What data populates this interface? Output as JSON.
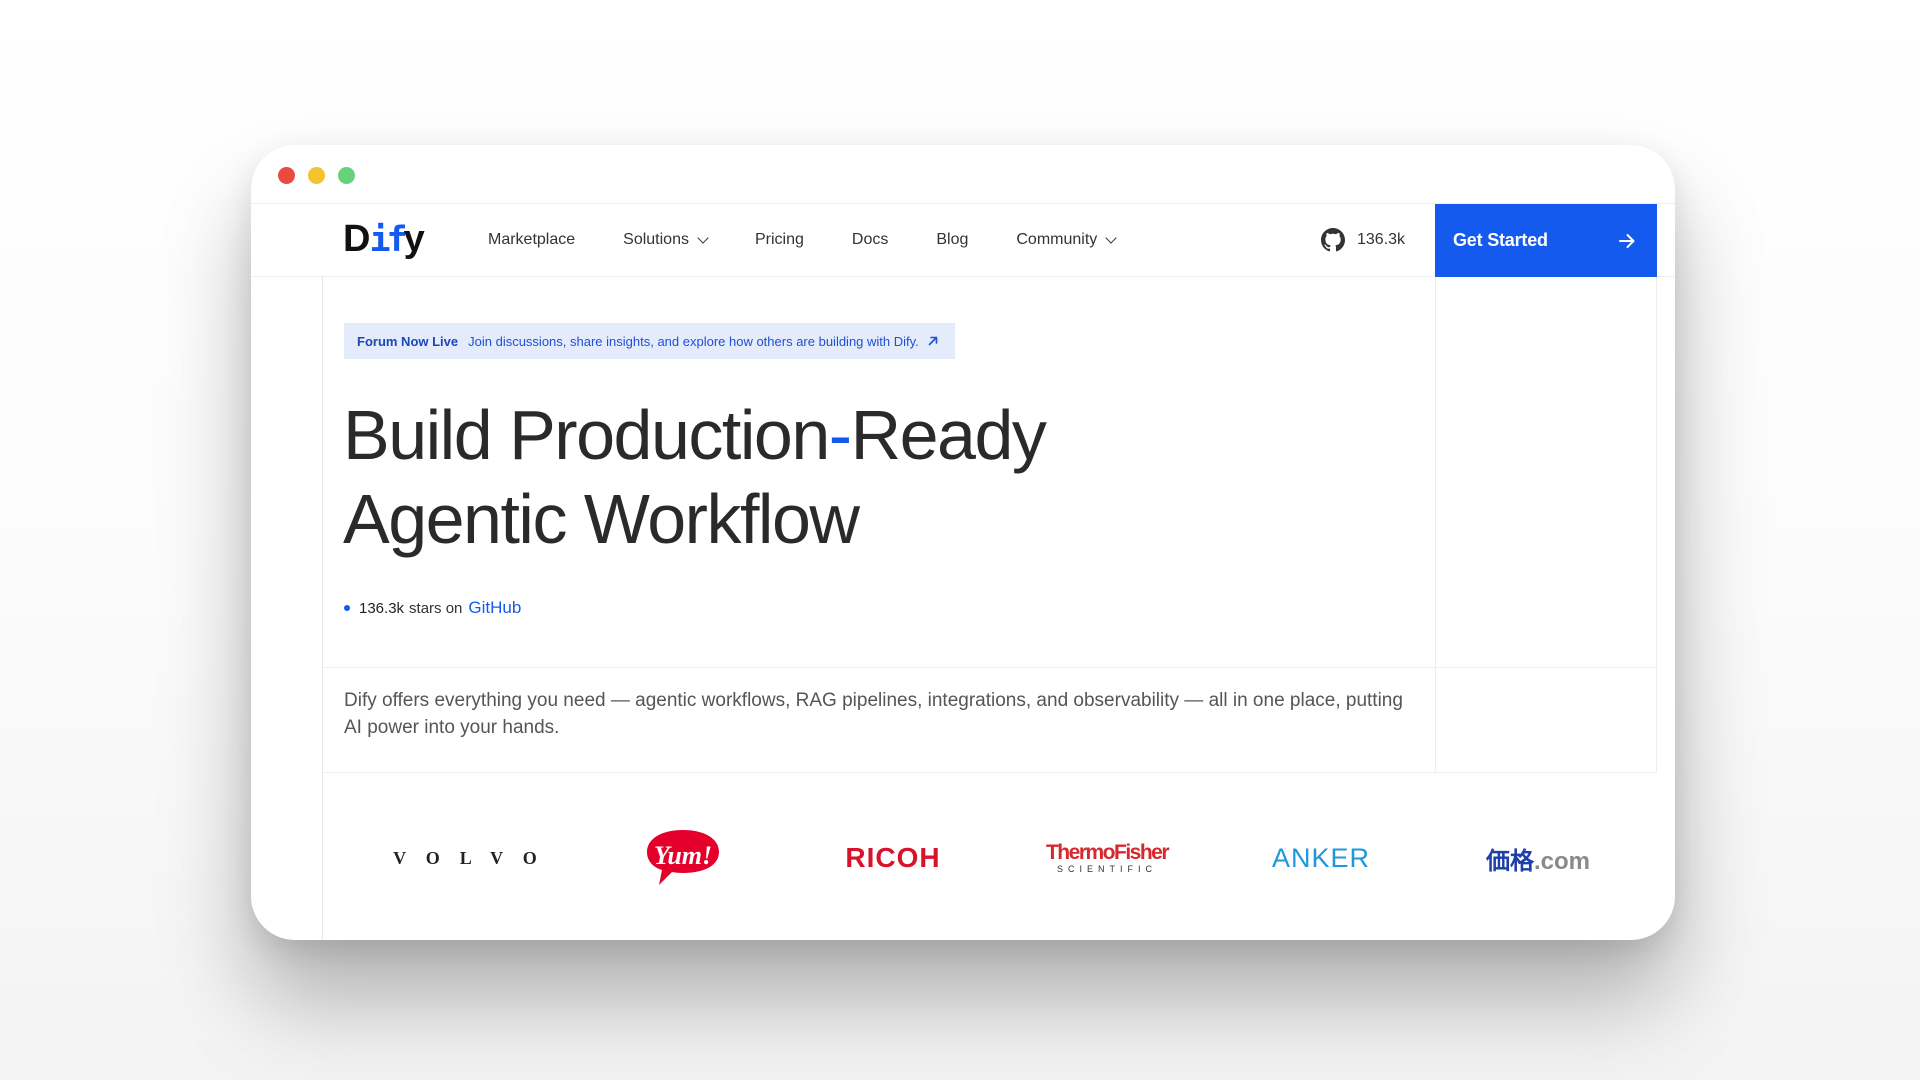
{
  "nav": {
    "logo": "Dify",
    "items": [
      {
        "label": "Marketplace",
        "has_dropdown": false
      },
      {
        "label": "Solutions",
        "has_dropdown": true
      },
      {
        "label": "Pricing",
        "has_dropdown": false
      },
      {
        "label": "Docs",
        "has_dropdown": false
      },
      {
        "label": "Blog",
        "has_dropdown": false
      },
      {
        "label": "Community",
        "has_dropdown": true
      }
    ],
    "github_stars": "136.3k",
    "cta_label": "Get Started"
  },
  "banner": {
    "badge": "Forum Now Live",
    "text": "Join discussions, share insights, and explore how others are building with Dify."
  },
  "hero": {
    "line1_a": "Build Production",
    "line1_dash": "-",
    "line1_b": "Ready",
    "line2": "Agentic Workflow"
  },
  "stars": {
    "count": "136.3k",
    "middle": "stars on",
    "link": "GitHub"
  },
  "description": "Dify offers everything you need — agentic workflows, RAG pipelines, integrations, and observability — all in one place, putting AI power into your hands.",
  "logos": {
    "volvo": "VOLVO",
    "yum": "Yum!",
    "ricoh": "RICOH",
    "thermo_top": "ThermoFisher",
    "thermo_bottom": "SCIENTIFIC",
    "anker": "ANKER",
    "kakaku_jp": "価格",
    "kakaku_com": ".com"
  },
  "colors": {
    "accent": "#155aef",
    "banner_bg": "#e4ebfb",
    "ricoh": "#d6132a",
    "thermo": "#d7282f",
    "anker": "#1e98db",
    "yum": "#e4002b"
  }
}
